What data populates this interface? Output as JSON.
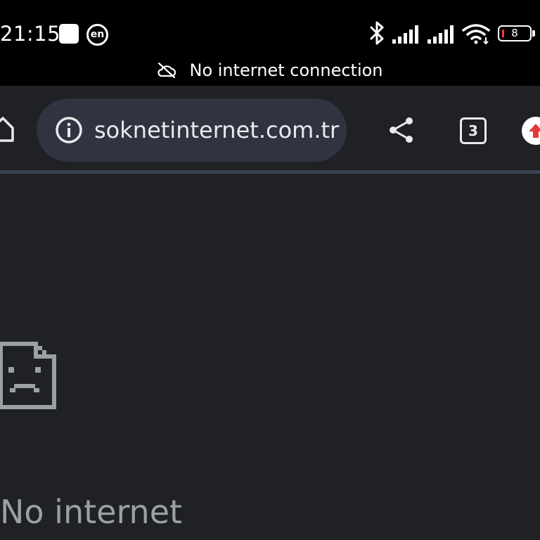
{
  "status_bar": {
    "time": "21:15",
    "language_badge": "en",
    "battery_level": "8",
    "icons": [
      "notification-square-icon",
      "language-badge-icon",
      "bluetooth-icon",
      "signal-icon",
      "signal-icon",
      "wifi-icon",
      "battery-icon"
    ]
  },
  "offline_banner": {
    "icon": "cloud-off-icon",
    "text": "No internet connection"
  },
  "toolbar": {
    "home_icon": "home-icon",
    "site_info_icon": "info-icon",
    "url": "soknetinternet.com.tr",
    "share_icon": "share-icon",
    "tab_count": "3",
    "update_icon": "update-arrow-icon"
  },
  "content": {
    "error_icon": "sad-document-icon",
    "error_title": "No internet"
  },
  "colors": {
    "status_bar_bg": "#000000",
    "page_bg": "#202124",
    "omnibox_bg": "#2f3440",
    "text_primary": "#e8eaed",
    "text_secondary": "#9aa0a6",
    "update_accent": "#e53935",
    "battery_low": "#ff3b30"
  }
}
